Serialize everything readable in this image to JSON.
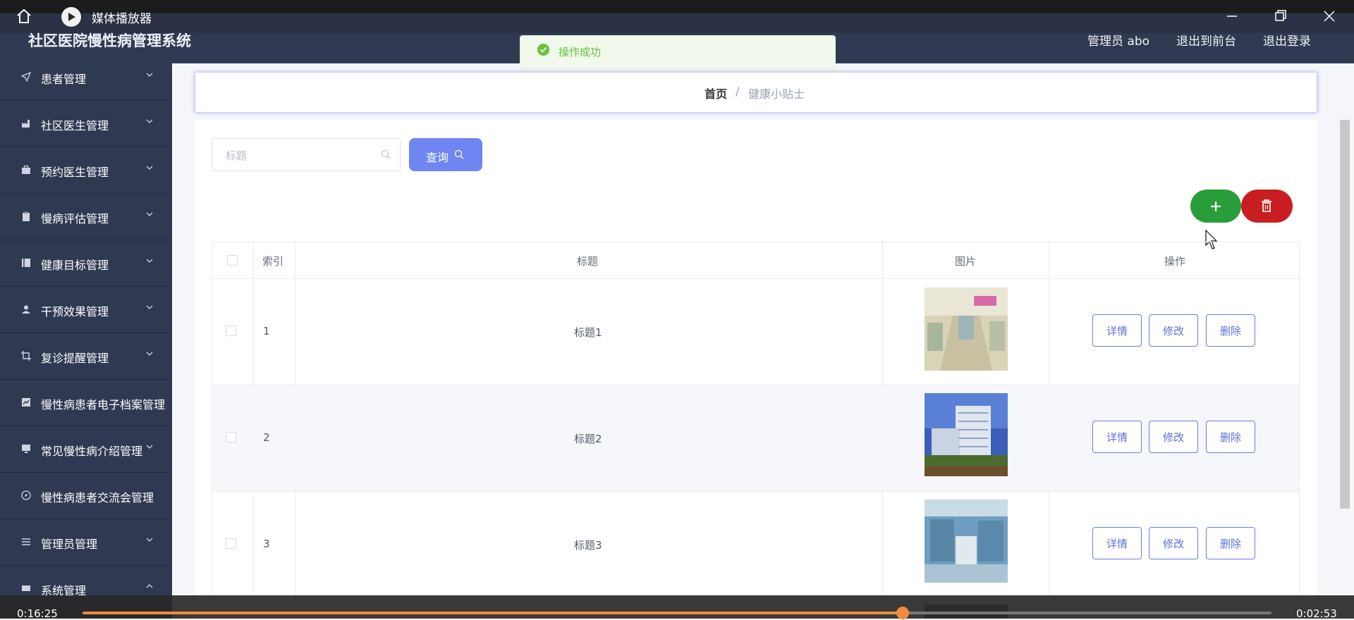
{
  "player": {
    "title": "媒体播放器",
    "elapsed": "0:16:25",
    "total": "0:02:53",
    "progress_fraction": 0.69,
    "accent": "#f08a3c"
  },
  "header": {
    "app_title": "社区医院慢性病管理系统",
    "user": "管理员 abo",
    "back_frontend": "退出到前台",
    "logout": "退出登录"
  },
  "toast": {
    "message": "操作成功",
    "icon": "check-circle-icon"
  },
  "sidebar": {
    "items": [
      {
        "label": "患者管理",
        "icon": "paper-plane-icon"
      },
      {
        "label": "社区医生管理",
        "icon": "factory-icon"
      },
      {
        "label": "预约医生管理",
        "icon": "briefcase-icon"
      },
      {
        "label": "慢病评估管理",
        "icon": "clipboard-icon"
      },
      {
        "label": "健康目标管理",
        "icon": "notebook-icon"
      },
      {
        "label": "干预效果管理",
        "icon": "user-icon"
      },
      {
        "label": "复诊提醒管理",
        "icon": "crop-icon"
      },
      {
        "label": "慢性病患者电子档案管理",
        "icon": "chart-icon"
      },
      {
        "label": "常见慢性病介绍管理",
        "icon": "monitor-icon"
      },
      {
        "label": "慢性病患者交流会管理",
        "icon": "compass-icon"
      },
      {
        "label": "管理员管理",
        "icon": "list-icon"
      },
      {
        "label": "系统管理",
        "icon": "settings-icon"
      }
    ]
  },
  "breadcrumb": {
    "home": "首页",
    "separator": "/",
    "current": "健康小贴士"
  },
  "search": {
    "placeholder": "标题",
    "button": "查询"
  },
  "table": {
    "headers": {
      "index": "索引",
      "title": "标题",
      "image": "图片",
      "actions": "操作"
    },
    "rows": [
      {
        "index": "1",
        "title": "标题1",
        "image": "hospital-corridor"
      },
      {
        "index": "2",
        "title": "标题2",
        "image": "hospital-building"
      },
      {
        "index": "3",
        "title": "标题3",
        "image": "operating-room"
      }
    ],
    "actions": {
      "detail": "详情",
      "edit": "修改",
      "delete": "删除"
    }
  },
  "colors": {
    "sidebar": "#2f3a52",
    "primary": "#6f86f2",
    "add": "#2a9d3b",
    "danger": "#c81e21",
    "success": "#67c23a"
  }
}
